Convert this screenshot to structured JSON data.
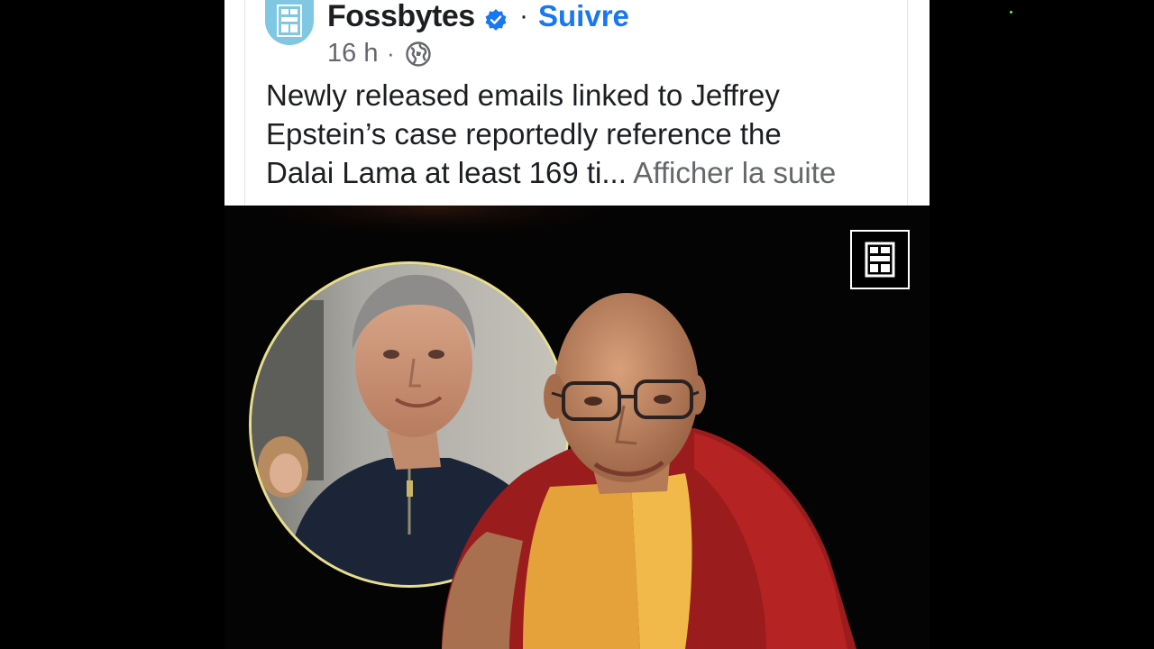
{
  "post": {
    "page_name": "Fossbytes",
    "separator": "·",
    "follow_label": "Suivre",
    "time": "16 h",
    "time_separator": "·",
    "text_lines": [
      "Newly released emails linked to Jeffrey",
      "Epstein’s case reportedly reference the",
      "Dalai Lama at least 169 ti..."
    ],
    "see_more_label": "Afficher la suite",
    "icons": {
      "verified": "verified-badge-icon",
      "audience": "globe-icon"
    }
  },
  "colors": {
    "link": "#1877f2",
    "secondary_text": "#65676b",
    "primary_text": "#1c1e21",
    "portrait_ring": "#e8de8c",
    "avatar_bg": "#7fc7e2"
  }
}
